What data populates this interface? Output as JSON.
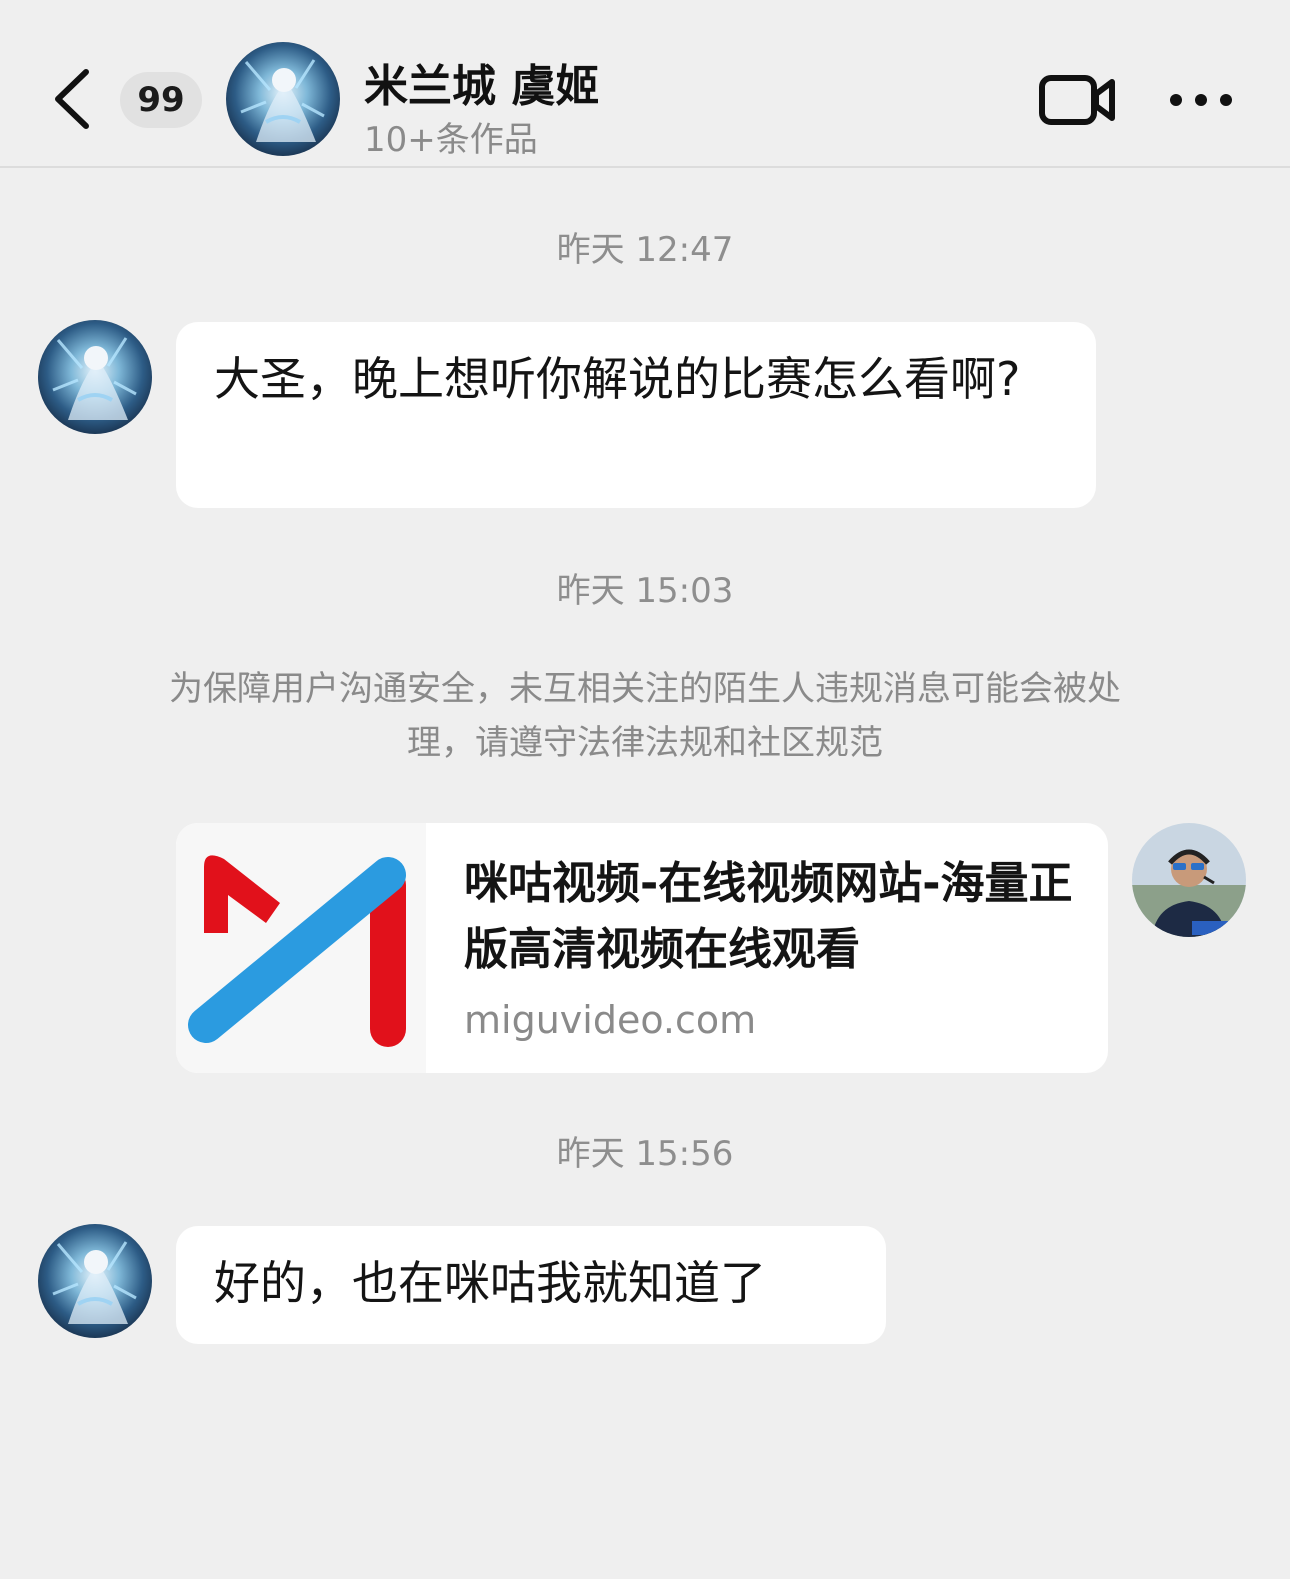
{
  "header": {
    "back_icon": "chevron-left-icon",
    "unread_count": "99",
    "title": "米兰城 虞姬",
    "subtitle": "10+条作品",
    "video_call_icon": "video-camera-icon",
    "more_icon": "more-horizontal-icon"
  },
  "messages": [
    {
      "type": "timestamp",
      "text": "昨天 12:47"
    },
    {
      "type": "text",
      "side": "left",
      "text": "大圣，晚上想听你解说的比赛怎么看啊?"
    },
    {
      "type": "timestamp",
      "text": "昨天 15:03"
    },
    {
      "type": "notice",
      "text": "为保障用户沟通安全，未互相关注的陌生人违规消息可能会被处理，请遵守法律法规和社区规范"
    },
    {
      "type": "link",
      "side": "right",
      "title": "咪咕视频-在线视频网站-海量正版高清视频在线观看",
      "domain": "miguvideo.com"
    },
    {
      "type": "timestamp",
      "text": "昨天 15:56"
    },
    {
      "type": "text",
      "side": "left",
      "text": "好的，也在咪咕我就知道了"
    }
  ],
  "colors": {
    "background": "#efefef",
    "bubble": "#ffffff",
    "migu_red": "#e1111b",
    "migu_blue": "#2b9be0"
  }
}
